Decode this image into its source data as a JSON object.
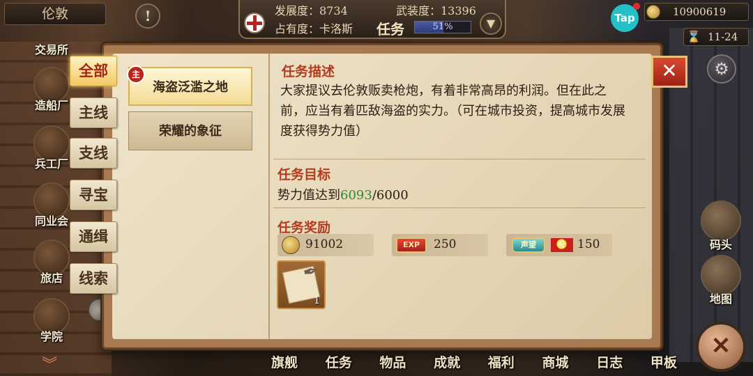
{
  "topbar": {
    "city_name": "伦敦",
    "alert_icon": "!",
    "development": "发展度：8734",
    "armament": "武装度：13396",
    "occupation": "占有度：卡洛斯",
    "quest_label": "任务",
    "quest_progress_text": "51%",
    "quest_progress": 0.51,
    "tap_label": "Tap",
    "gold": "10900619",
    "date": "11-24"
  },
  "city_menu": [
    {
      "label": "交易所",
      "icon": "exchange-icon"
    },
    {
      "label": "造船厂",
      "icon": "shipyard-icon"
    },
    {
      "label": "兵工厂",
      "icon": "arsenal-icon"
    },
    {
      "label": "同业会",
      "icon": "guild-icon"
    },
    {
      "label": "旅店",
      "icon": "inn-icon"
    },
    {
      "label": "学院",
      "icon": "academy-icon"
    }
  ],
  "right_menu": [
    {
      "label": "码头",
      "icon": "dock-icon"
    },
    {
      "label": "地图",
      "icon": "map-icon"
    }
  ],
  "bottom_nav": [
    "旗舰",
    "任务",
    "物品",
    "成就",
    "福利",
    "商城",
    "日志",
    "甲板"
  ],
  "categories": [
    "全部",
    "主线",
    "支线",
    "寻宝",
    "通缉",
    "线索"
  ],
  "quests": [
    {
      "title": "海盗泛滥之地",
      "badge": "主"
    },
    {
      "title": "荣耀的象征"
    }
  ],
  "detail": {
    "desc_heading": "任务描述",
    "desc_text": "大家提议去伦敦贩卖枪炮，有着非常高昂的利润。但在此之前，应当有着匹敌海盗的实力。（可在城市投资，提高城市发展度获得势力值）",
    "goal_heading": "任务目标",
    "goal_prefix": "势力值达到",
    "goal_current": "6093",
    "goal_target": "/6000",
    "reward_heading": "任务奖励",
    "reward_gold": "91002",
    "reward_exp_icon": "EXP",
    "reward_exp": "250",
    "reward_fame_icon": "声望",
    "reward_fame": "150",
    "reward_item_count": "1"
  },
  "colors": {
    "accent_red": "#b33c1f",
    "goal_green": "#2f8a2c",
    "parchment": "#efe4cb"
  }
}
